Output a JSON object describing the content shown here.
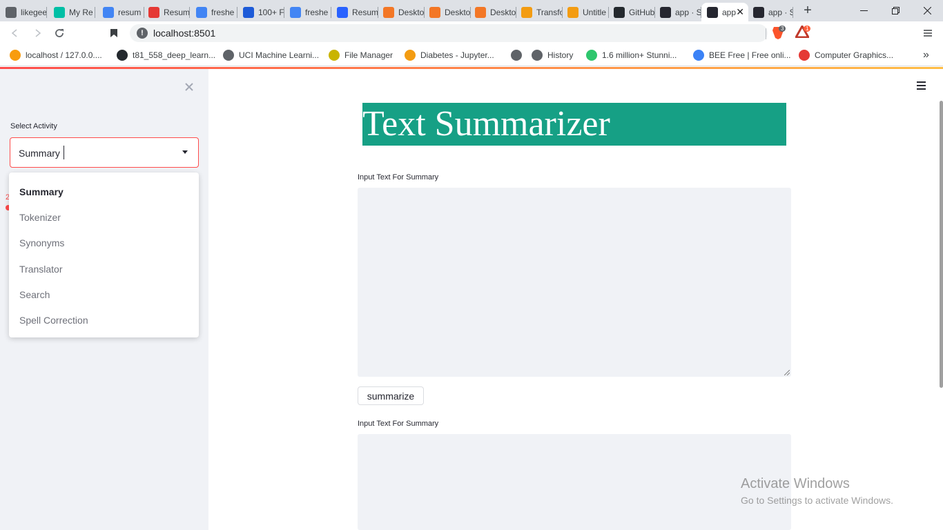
{
  "browser": {
    "tabs": [
      {
        "label": "likegee",
        "icon": "globe-icon",
        "color": "#5f6368"
      },
      {
        "label": "My Re",
        "icon": "infinity-icon",
        "color": "#00bfa5"
      },
      {
        "label": "resum",
        "icon": "google-icon",
        "color": "#4285f4"
      },
      {
        "label": "Resum",
        "icon": "resume-icon",
        "color": "#e53935"
      },
      {
        "label": "freshe",
        "icon": "google-icon",
        "color": "#4285f4"
      },
      {
        "label": "100+ F",
        "icon": "r-icon",
        "color": "#1e5bd8"
      },
      {
        "label": "freshe",
        "icon": "google-icon",
        "color": "#4285f4"
      },
      {
        "label": "Resum",
        "icon": "k-icon",
        "color": "#2962ff"
      },
      {
        "label": "Deskto",
        "icon": "jupyter-icon",
        "color": "#f37726"
      },
      {
        "label": "Deskto",
        "icon": "jupyter-icon",
        "color": "#f37726"
      },
      {
        "label": "Deskto",
        "icon": "jupyter-icon",
        "color": "#f37726"
      },
      {
        "label": "Transfo",
        "icon": "notebook-icon",
        "color": "#f39c12"
      },
      {
        "label": "Untitle",
        "icon": "notebook-icon",
        "color": "#f39c12"
      },
      {
        "label": "GitHub",
        "icon": "github-icon",
        "color": "#24292e"
      },
      {
        "label": "app · S",
        "icon": "streamlit-icon",
        "color": "#262730"
      },
      {
        "label": "app",
        "icon": "streamlit-icon",
        "color": "#262730",
        "active": true
      },
      {
        "label": "app · S",
        "icon": "streamlit-icon",
        "color": "#262730"
      }
    ],
    "new_tab": "+",
    "url": "localhost:8501",
    "brave_badge": "3",
    "rewards_badge": "1",
    "bookmarks": [
      {
        "label": "localhost / 127.0.0....",
        "icon": "phpmyadmin-icon",
        "color": "#f89c0e"
      },
      {
        "label": "t81_558_deep_learn...",
        "icon": "github-icon",
        "color": "#24292e"
      },
      {
        "label": "UCI Machine Learni...",
        "icon": "globe-icon",
        "color": "#5f6368"
      },
      {
        "label": "File Manager",
        "icon": "file-manager-icon",
        "color": "#c9b400"
      },
      {
        "label": "Diabetes - Jupyter...",
        "icon": "notebook-icon",
        "color": "#f39c12"
      },
      {
        "label": "",
        "icon": "globe-icon",
        "color": "#5f6368"
      },
      {
        "label": "History",
        "icon": "history-icon",
        "color": "#5f6368"
      },
      {
        "label": "1.6 million+ Stunni...",
        "icon": "pixabay-icon",
        "color": "#2ec66d"
      },
      {
        "label": "BEE Free | Free onli...",
        "icon": "bee-icon",
        "color": "#3b82f6"
      },
      {
        "label": "Computer Graphics...",
        "icon": "vlogo-icon",
        "color": "#e53935"
      }
    ],
    "overflow": "»"
  },
  "sidebar": {
    "select_label": "Select Activity",
    "selected_value": "Summary",
    "options": [
      "Summary",
      "Tokenizer",
      "Synonyms",
      "Translator",
      "Search",
      "Spell Correction"
    ],
    "behind_text": "2"
  },
  "main": {
    "title": "Text Summarizer",
    "input_label": "Input Text For Summary",
    "input_value": "",
    "button_label": "summarize",
    "output_label": "Input Text For Summary",
    "output_value": ""
  },
  "watermark": {
    "line1": "Activate Windows",
    "line2": "Go to Settings to activate Windows."
  },
  "colors": {
    "accent": "#ff4b4b",
    "title_bg": "#16a085",
    "sidebar_bg": "#f0f2f6"
  }
}
